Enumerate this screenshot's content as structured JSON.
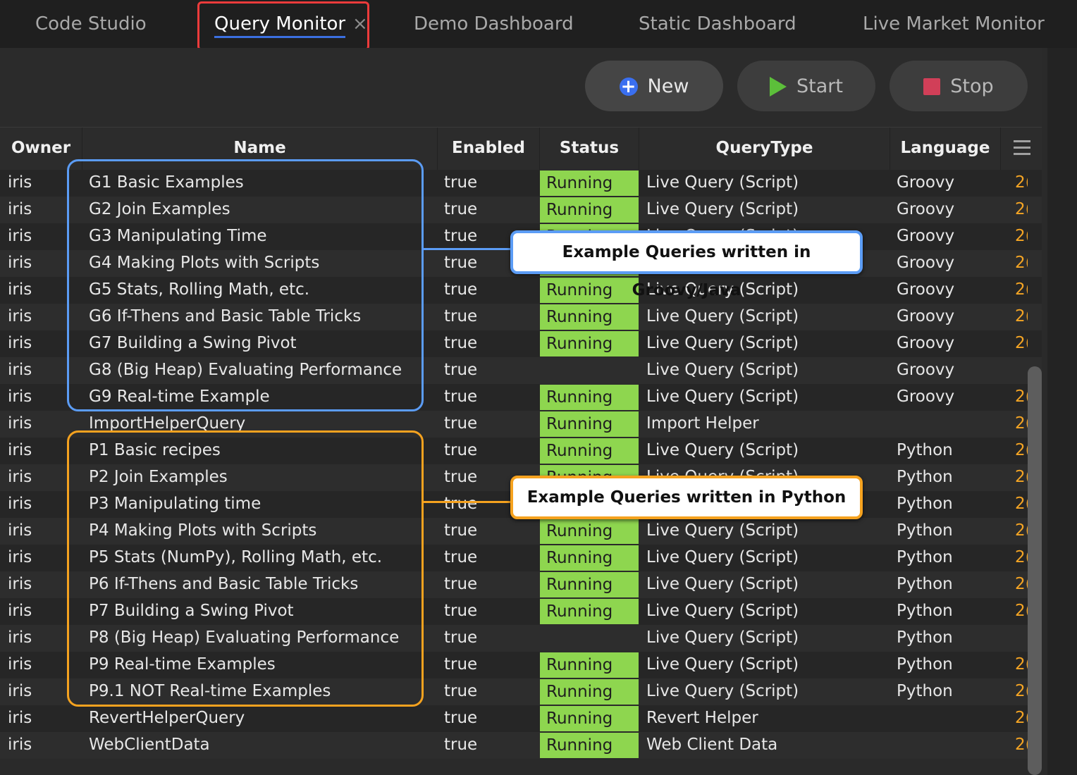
{
  "tabs": [
    {
      "label": "Code Studio"
    },
    {
      "label": "Query Monitor",
      "close": "×"
    },
    {
      "label": "Demo Dashboard"
    },
    {
      "label": "Static Dashboard"
    },
    {
      "label": "Live Market Monitor"
    }
  ],
  "toolbar": {
    "new_label": "New",
    "start_label": "Start",
    "stop_label": "Stop"
  },
  "table": {
    "columns": [
      "Owner",
      "Name",
      "Enabled",
      "Status",
      "QueryType",
      "Language"
    ],
    "rows": [
      {
        "owner": "iris",
        "name": "G1 Basic Examples",
        "enabled": "true",
        "status": "Running",
        "type": "Live Query (Script)",
        "language": "Groovy",
        "extra": "2("
      },
      {
        "owner": "iris",
        "name": "G2 Join Examples",
        "enabled": "true",
        "status": "Running",
        "type": "Live Query (Script)",
        "language": "Groovy",
        "extra": "2("
      },
      {
        "owner": "iris",
        "name": "G3 Manipulating Time",
        "enabled": "true",
        "status": "Running",
        "type": "Live Query (Script)",
        "language": "Groovy",
        "extra": "2("
      },
      {
        "owner": "iris",
        "name": "G4 Making Plots with Scripts",
        "enabled": "true",
        "status": "Running",
        "type": "Live Query (Script)",
        "language": "Groovy",
        "extra": "2("
      },
      {
        "owner": "iris",
        "name": "G5 Stats, Rolling Math, etc.",
        "enabled": "true",
        "status": "Running",
        "type": "Live Query (Script)",
        "language": "Groovy",
        "extra": "2("
      },
      {
        "owner": "iris",
        "name": "G6 If-Thens and Basic Table Tricks",
        "enabled": "true",
        "status": "Running",
        "type": "Live Query (Script)",
        "language": "Groovy",
        "extra": "2("
      },
      {
        "owner": "iris",
        "name": "G7 Building a Swing Pivot",
        "enabled": "true",
        "status": "Running",
        "type": "Live Query (Script)",
        "language": "Groovy",
        "extra": "2("
      },
      {
        "owner": "iris",
        "name": "G8 (Big Heap) Evaluating Performance",
        "enabled": "true",
        "status": "",
        "type": "Live Query (Script)",
        "language": "Groovy",
        "extra": ""
      },
      {
        "owner": "iris",
        "name": "G9 Real-time Example",
        "enabled": "true",
        "status": "Running",
        "type": "Live Query (Script)",
        "language": "Groovy",
        "extra": "2("
      },
      {
        "owner": "iris",
        "name": "ImportHelperQuery",
        "enabled": "true",
        "status": "Running",
        "type": "Import Helper",
        "language": "",
        "extra": "2("
      },
      {
        "owner": "iris",
        "name": "P1 Basic recipes",
        "enabled": "true",
        "status": "Running",
        "type": "Live Query (Script)",
        "language": "Python",
        "extra": "2("
      },
      {
        "owner": "iris",
        "name": "P2 Join Examples",
        "enabled": "true",
        "status": "Running",
        "type": "Live Query (Script)",
        "language": "Python",
        "extra": "2("
      },
      {
        "owner": "iris",
        "name": "P3 Manipulating time",
        "enabled": "true",
        "status": "Running",
        "type": "Live Query (Script)",
        "language": "Python",
        "extra": "2("
      },
      {
        "owner": "iris",
        "name": "P4 Making Plots with Scripts",
        "enabled": "true",
        "status": "Running",
        "type": "Live Query (Script)",
        "language": "Python",
        "extra": "2("
      },
      {
        "owner": "iris",
        "name": "P5 Stats (NumPy), Rolling Math, etc.",
        "enabled": "true",
        "status": "Running",
        "type": "Live Query (Script)",
        "language": "Python",
        "extra": "2("
      },
      {
        "owner": "iris",
        "name": "P6 If-Thens and Basic Table Tricks",
        "enabled": "true",
        "status": "Running",
        "type": "Live Query (Script)",
        "language": "Python",
        "extra": "2("
      },
      {
        "owner": "iris",
        "name": "P7 Building a Swing Pivot",
        "enabled": "true",
        "status": "Running",
        "type": "Live Query (Script)",
        "language": "Python",
        "extra": "2("
      },
      {
        "owner": "iris",
        "name": "P8 (Big Heap) Evaluating Performance",
        "enabled": "true",
        "status": "",
        "type": "Live Query (Script)",
        "language": "Python",
        "extra": ""
      },
      {
        "owner": "iris",
        "name": "P9 Real-time Examples",
        "enabled": "true",
        "status": "Running",
        "type": "Live Query (Script)",
        "language": "Python",
        "extra": "2("
      },
      {
        "owner": "iris",
        "name": "P9.1 NOT Real-time Examples",
        "enabled": "true",
        "status": "Running",
        "type": "Live Query (Script)",
        "language": "Python",
        "extra": "2("
      },
      {
        "owner": "iris",
        "name": "RevertHelperQuery",
        "enabled": "true",
        "status": "Running",
        "type": "Revert Helper",
        "language": "",
        "extra": "2("
      },
      {
        "owner": "iris",
        "name": "WebClientData",
        "enabled": "true",
        "status": "Running",
        "type": "Web Client Data",
        "language": "",
        "extra": "2("
      }
    ]
  },
  "callouts": {
    "groovy": "Example Queries written in Groovy/Java",
    "python": "Example Queries written in Python"
  },
  "colors": {
    "running_bg": "#8ed64f",
    "groovy_accent": "#5b9cf5",
    "python_accent": "#f5a21f",
    "tab_highlight": "#ec3b3b",
    "tab_underline": "#3b6fe0",
    "new_icon": "#3a6ff0",
    "start_icon": "#5cbf3a",
    "stop_icon": "#d13f58"
  },
  "icons": {
    "new": "plus-circle-icon",
    "start": "play-icon",
    "stop": "stop-square-icon",
    "column_menu": "hamburger-menu-icon",
    "tab_close": "close-icon"
  }
}
